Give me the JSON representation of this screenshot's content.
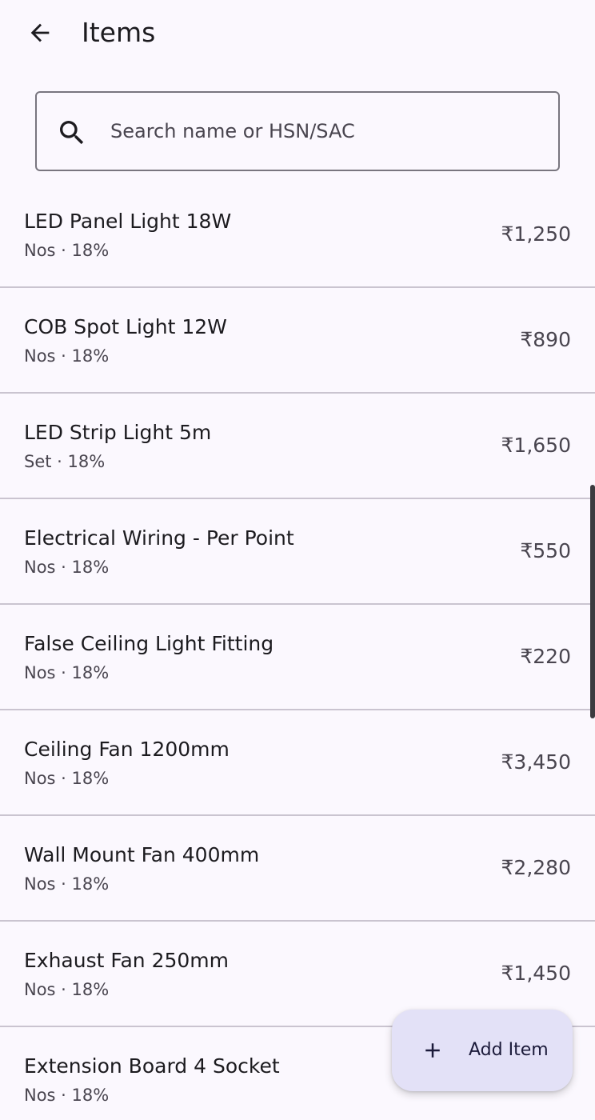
{
  "header": {
    "title": "Items",
    "back_icon": "arrow-back-icon"
  },
  "search": {
    "placeholder": "Search name or HSN/SAC",
    "value": "",
    "icon": "search-icon"
  },
  "items": [
    {
      "name": "LED Panel Light 18W",
      "meta": "Nos · 18%",
      "price": "₹1,250"
    },
    {
      "name": "COB Spot Light 12W",
      "meta": "Nos · 18%",
      "price": "₹890"
    },
    {
      "name": "LED Strip Light 5m",
      "meta": "Set · 18%",
      "price": "₹1,650"
    },
    {
      "name": "Electrical Wiring - Per Point",
      "meta": "Nos · 18%",
      "price": "₹550"
    },
    {
      "name": "False Ceiling Light Fitting",
      "meta": "Nos · 18%",
      "price": "₹220"
    },
    {
      "name": "Ceiling Fan 1200mm",
      "meta": "Nos · 18%",
      "price": "₹3,450"
    },
    {
      "name": "Wall Mount Fan 400mm",
      "meta": "Nos · 18%",
      "price": "₹2,280"
    },
    {
      "name": "Exhaust Fan 250mm",
      "meta": "Nos · 18%",
      "price": "₹1,450"
    },
    {
      "name": "Extension Board 4 Socket",
      "meta": "Nos · 18%",
      "price": ""
    }
  ],
  "fab": {
    "label": "Add Item",
    "icon": "plus-icon"
  },
  "colors": {
    "background": "#fbf8fe",
    "divider": "#cac4d0",
    "fab_background": "#e3e1f7",
    "text_primary": "#1c1b1f",
    "text_secondary": "#49454f"
  }
}
